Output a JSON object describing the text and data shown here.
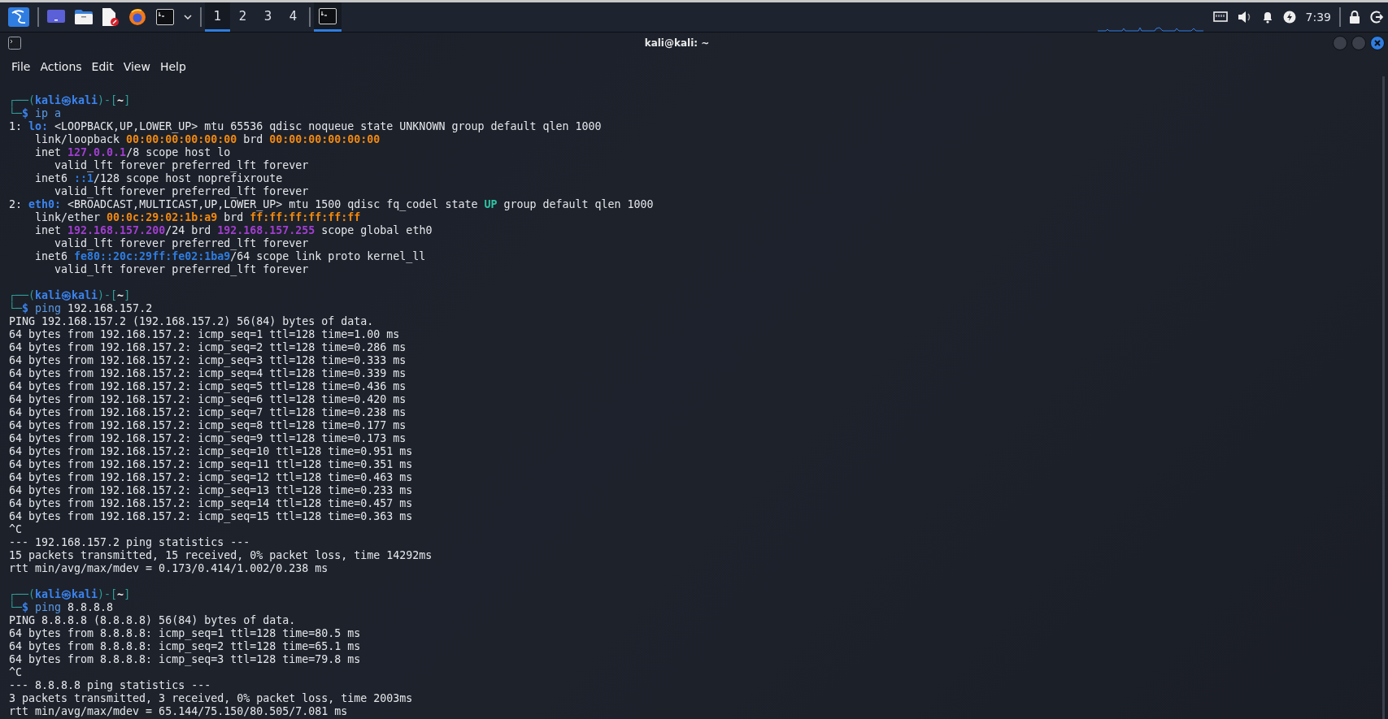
{
  "taskbar": {
    "workspaces": [
      {
        "label": "1",
        "selected": true
      },
      {
        "label": "2",
        "selected": false
      },
      {
        "label": "3",
        "selected": false
      },
      {
        "label": "4",
        "selected": false
      }
    ],
    "task": {
      "selected": true
    },
    "clock": "7:39"
  },
  "window": {
    "title": "kali@kali: ~",
    "menu": [
      "File",
      "Actions",
      "Edit",
      "View",
      "Help"
    ]
  },
  "terminal": {
    "blocks": [
      {
        "lines": [
          {
            "spans": [
              {
                "text": "┌──(",
                "kind": "frame"
              },
              {
                "text": "kali㉿kali",
                "kind": "host"
              },
              {
                "text": ")-[",
                "kind": "frame"
              },
              {
                "text": "~",
                "kind": "dir"
              },
              {
                "text": "]",
                "kind": "frame"
              }
            ]
          },
          {
            "spans": [
              {
                "text": "└─",
                "kind": "frame"
              },
              {
                "text": "$",
                "kind": "sigil"
              },
              {
                "text": " ip a",
                "kind": "cmd"
              }
            ]
          },
          {
            "spans": [
              {
                "text": "1: ",
                "kind": "plain"
              },
              {
                "text": "lo:",
                "kind": "iface"
              },
              {
                "text": " <LOOPBACK,UP,LOWER_UP> mtu 65536 qdisc noqueue state UNKNOWN group default qlen 1000",
                "kind": "plain"
              }
            ]
          },
          {
            "spans": [
              {
                "text": "    link/loopback ",
                "kind": "plain"
              },
              {
                "text": "00:00:00:00:00:00",
                "kind": "mac"
              },
              {
                "text": " brd ",
                "kind": "plain"
              },
              {
                "text": "00:00:00:00:00:00",
                "kind": "mac"
              }
            ]
          },
          {
            "spans": [
              {
                "text": "    inet ",
                "kind": "plain"
              },
              {
                "text": "127.0.0.1",
                "kind": "ipv4"
              },
              {
                "text": "/8 scope host lo",
                "kind": "plain"
              }
            ]
          },
          {
            "spans": [
              {
                "text": "       valid_lft forever preferred_lft forever",
                "kind": "plain"
              }
            ]
          },
          {
            "spans": [
              {
                "text": "    inet6 ",
                "kind": "plain"
              },
              {
                "text": "::1",
                "kind": "ipv6"
              },
              {
                "text": "/128 scope host noprefixroute",
                "kind": "plain"
              }
            ]
          },
          {
            "spans": [
              {
                "text": "       valid_lft forever preferred_lft forever",
                "kind": "plain"
              }
            ]
          },
          {
            "spans": [
              {
                "text": "2: ",
                "kind": "plain"
              },
              {
                "text": "eth0:",
                "kind": "iface"
              },
              {
                "text": " <BROADCAST,MULTICAST,UP,LOWER_UP> mtu 1500 qdisc fq_codel state ",
                "kind": "plain"
              },
              {
                "text": "UP",
                "kind": "state"
              },
              {
                "text": " group default qlen 1000",
                "kind": "plain"
              }
            ]
          },
          {
            "spans": [
              {
                "text": "    link/ether ",
                "kind": "plain"
              },
              {
                "text": "00:0c:29:02:1b:a9",
                "kind": "mac"
              },
              {
                "text": " brd ",
                "kind": "plain"
              },
              {
                "text": "ff:ff:ff:ff:ff:ff",
                "kind": "mac"
              }
            ]
          },
          {
            "spans": [
              {
                "text": "    inet ",
                "kind": "plain"
              },
              {
                "text": "192.168.157.200",
                "kind": "ipv4"
              },
              {
                "text": "/24 brd ",
                "kind": "plain"
              },
              {
                "text": "192.168.157.255",
                "kind": "ipv4"
              },
              {
                "text": " scope global eth0",
                "kind": "plain"
              }
            ]
          },
          {
            "spans": [
              {
                "text": "       valid_lft forever preferred_lft forever",
                "kind": "plain"
              }
            ]
          },
          {
            "spans": [
              {
                "text": "    inet6 ",
                "kind": "plain"
              },
              {
                "text": "fe80::20c:29ff:fe02:1ba9",
                "kind": "ipv6"
              },
              {
                "text": "/64 scope link proto kernel_ll",
                "kind": "plain"
              }
            ]
          },
          {
            "spans": [
              {
                "text": "       valid_lft forever preferred_lft forever",
                "kind": "plain"
              }
            ]
          }
        ]
      },
      {
        "lines": [
          {
            "spans": [
              {
                "text": "┌──(",
                "kind": "frame"
              },
              {
                "text": "kali㉿kali",
                "kind": "host"
              },
              {
                "text": ")-[",
                "kind": "frame"
              },
              {
                "text": "~",
                "kind": "dir"
              },
              {
                "text": "]",
                "kind": "frame"
              }
            ]
          },
          {
            "spans": [
              {
                "text": "└─",
                "kind": "frame"
              },
              {
                "text": "$",
                "kind": "sigil"
              },
              {
                "text": " ping",
                "kind": "cmd"
              },
              {
                "text": " 192.168.157.2",
                "kind": "plain"
              }
            ]
          },
          {
            "spans": [
              {
                "text": "PING 192.168.157.2 (192.168.157.2) 56(84) bytes of data.",
                "kind": "plain"
              }
            ]
          },
          {
            "spans": [
              {
                "text": "64 bytes from 192.168.157.2: icmp_seq=1 ttl=128 time=1.00 ms",
                "kind": "plain"
              }
            ]
          },
          {
            "spans": [
              {
                "text": "64 bytes from 192.168.157.2: icmp_seq=2 ttl=128 time=0.286 ms",
                "kind": "plain"
              }
            ]
          },
          {
            "spans": [
              {
                "text": "64 bytes from 192.168.157.2: icmp_seq=3 ttl=128 time=0.333 ms",
                "kind": "plain"
              }
            ]
          },
          {
            "spans": [
              {
                "text": "64 bytes from 192.168.157.2: icmp_seq=4 ttl=128 time=0.339 ms",
                "kind": "plain"
              }
            ]
          },
          {
            "spans": [
              {
                "text": "64 bytes from 192.168.157.2: icmp_seq=5 ttl=128 time=0.436 ms",
                "kind": "plain"
              }
            ]
          },
          {
            "spans": [
              {
                "text": "64 bytes from 192.168.157.2: icmp_seq=6 ttl=128 time=0.420 ms",
                "kind": "plain"
              }
            ]
          },
          {
            "spans": [
              {
                "text": "64 bytes from 192.168.157.2: icmp_seq=7 ttl=128 time=0.238 ms",
                "kind": "plain"
              }
            ]
          },
          {
            "spans": [
              {
                "text": "64 bytes from 192.168.157.2: icmp_seq=8 ttl=128 time=0.177 ms",
                "kind": "plain"
              }
            ]
          },
          {
            "spans": [
              {
                "text": "64 bytes from 192.168.157.2: icmp_seq=9 ttl=128 time=0.173 ms",
                "kind": "plain"
              }
            ]
          },
          {
            "spans": [
              {
                "text": "64 bytes from 192.168.157.2: icmp_seq=10 ttl=128 time=0.951 ms",
                "kind": "plain"
              }
            ]
          },
          {
            "spans": [
              {
                "text": "64 bytes from 192.168.157.2: icmp_seq=11 ttl=128 time=0.351 ms",
                "kind": "plain"
              }
            ]
          },
          {
            "spans": [
              {
                "text": "64 bytes from 192.168.157.2: icmp_seq=12 ttl=128 time=0.463 ms",
                "kind": "plain"
              }
            ]
          },
          {
            "spans": [
              {
                "text": "64 bytes from 192.168.157.2: icmp_seq=13 ttl=128 time=0.233 ms",
                "kind": "plain"
              }
            ]
          },
          {
            "spans": [
              {
                "text": "64 bytes from 192.168.157.2: icmp_seq=14 ttl=128 time=0.457 ms",
                "kind": "plain"
              }
            ]
          },
          {
            "spans": [
              {
                "text": "64 bytes from 192.168.157.2: icmp_seq=15 ttl=128 time=0.363 ms",
                "kind": "plain"
              }
            ]
          },
          {
            "spans": [
              {
                "text": "^C",
                "kind": "plain"
              }
            ]
          },
          {
            "spans": [
              {
                "text": "--- 192.168.157.2 ping statistics ---",
                "kind": "plain"
              }
            ]
          },
          {
            "spans": [
              {
                "text": "15 packets transmitted, 15 received, 0% packet loss, time 14292ms",
                "kind": "plain"
              }
            ]
          },
          {
            "spans": [
              {
                "text": "rtt min/avg/max/mdev = 0.173/0.414/1.002/0.238 ms",
                "kind": "plain"
              }
            ]
          }
        ]
      },
      {
        "lines": [
          {
            "spans": [
              {
                "text": "┌──(",
                "kind": "frame"
              },
              {
                "text": "kali㉿kali",
                "kind": "host"
              },
              {
                "text": ")-[",
                "kind": "frame"
              },
              {
                "text": "~",
                "kind": "dir"
              },
              {
                "text": "]",
                "kind": "frame"
              }
            ]
          },
          {
            "spans": [
              {
                "text": "└─",
                "kind": "frame"
              },
              {
                "text": "$",
                "kind": "sigil"
              },
              {
                "text": " ping",
                "kind": "cmd"
              },
              {
                "text": " 8.8.8.8",
                "kind": "plain"
              }
            ]
          },
          {
            "spans": [
              {
                "text": "PING 8.8.8.8 (8.8.8.8) 56(84) bytes of data.",
                "kind": "plain"
              }
            ]
          },
          {
            "spans": [
              {
                "text": "64 bytes from 8.8.8.8: icmp_seq=1 ttl=128 time=80.5 ms",
                "kind": "plain"
              }
            ]
          },
          {
            "spans": [
              {
                "text": "64 bytes from 8.8.8.8: icmp_seq=2 ttl=128 time=65.1 ms",
                "kind": "plain"
              }
            ]
          },
          {
            "spans": [
              {
                "text": "64 bytes from 8.8.8.8: icmp_seq=3 ttl=128 time=79.8 ms",
                "kind": "plain"
              }
            ]
          },
          {
            "spans": [
              {
                "text": "^C",
                "kind": "plain"
              }
            ]
          },
          {
            "spans": [
              {
                "text": "--- 8.8.8.8 ping statistics ---",
                "kind": "plain"
              }
            ]
          },
          {
            "spans": [
              {
                "text": "3 packets transmitted, 3 received, 0% packet loss, time 2003ms",
                "kind": "plain"
              }
            ]
          },
          {
            "spans": [
              {
                "text": "rtt min/avg/max/mdev = 65.144/75.150/80.505/7.081 ms",
                "kind": "plain"
              }
            ]
          }
        ]
      }
    ]
  }
}
